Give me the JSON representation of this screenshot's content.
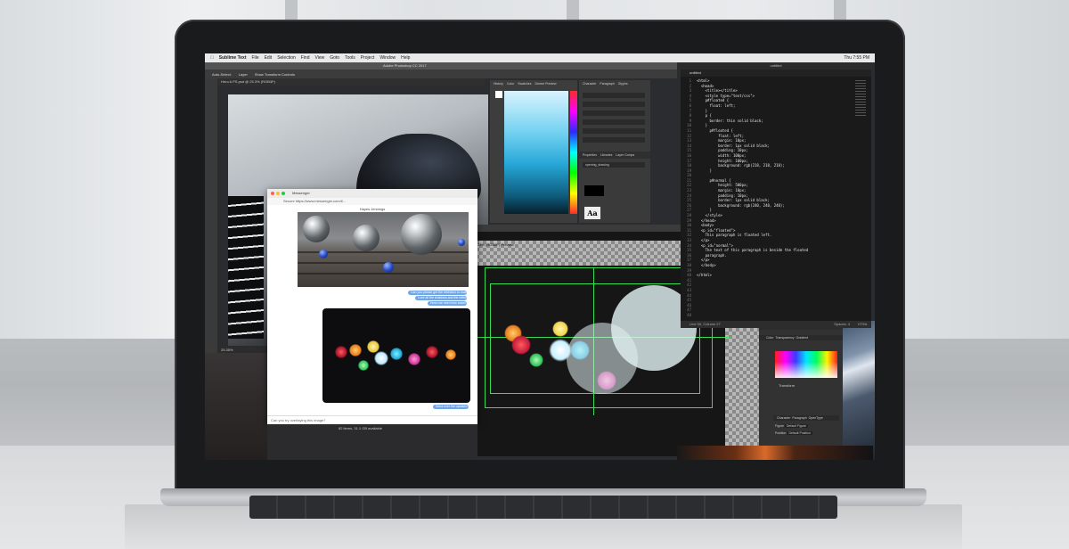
{
  "menubar": {
    "app_name": "Sublime Text",
    "items": [
      "File",
      "Edit",
      "Selection",
      "Find",
      "View",
      "Goto",
      "Tools",
      "Project",
      "Window",
      "Help"
    ],
    "clock": "Thu 7:55 PM"
  },
  "photoshop": {
    "window_title": "Adobe Photoshop CC 2017",
    "doc_tab": "Hero A PS.psd @ 25.3% (RGB/8*)",
    "zoom": "25.35%",
    "options_auto_select": "Auto-Select:",
    "options_layer": "Layer",
    "options_transform": "Show Transform Controls",
    "panel_tabs_color": [
      "History",
      "Color",
      "Swatches",
      "Device Preview"
    ],
    "panel_tabs_char": [
      "Character",
      "Paragraph",
      "Glyphs"
    ],
    "libraries_tabs": [
      "Properties",
      "Libraries",
      "Layer Comps"
    ],
    "library_name": "opening_drawing",
    "char_preview": "Aa",
    "lower_doc_tab": "33% (RGB/8*) Preview",
    "lower_opts": [
      "Stroke",
      "Opacity",
      "Fill",
      "Document Setup"
    ],
    "right_tabs": [
      "Color",
      "Transparency",
      "Gradient"
    ],
    "transform_label": "Transform",
    "char_tabs": [
      "Character",
      "Paragraph",
      "OpenType"
    ],
    "figure_label": "Figure",
    "figure_value": "Default Figure",
    "position_label": "Position",
    "position_value": "Default Position"
  },
  "messenger": {
    "title": "Messenger",
    "url": "Secure   https://www.messenger.com/t/...",
    "header": "Hayes Jennings",
    "bubbles": [
      "Can you please get the reflection to match?",
      "Love all the shadows and the reflections",
      "Hmm we need less bokeh?"
    ],
    "last_bubble": "Send over the updated file!",
    "input_placeholder": "Can you try overlaying this image?",
    "footer": "82 items, 31.1 GB available"
  },
  "editor": {
    "window_title": "untitled",
    "tab": "untitled",
    "status": "Line 50, Column 27",
    "status_right": "HTML",
    "right_label": "Spaces: 4",
    "line_numbers": "1\n2\n3\n4\n5\n6\n7\n8\n9\n10\n11\n12\n13\n14\n15\n16\n17\n18\n19\n20\n21\n22\n23\n24\n25\n26\n27\n28\n29\n30\n31\n32\n33\n34\n35\n36\n37\n38\n39\n40\n41\n42\n43\n44\n45\n46\n47\n48",
    "code": "<html>\n  <head>\n    <title></title>\n    <style type=\"text/css\">\n    p#floated {\n      float: left;\n    }\n    p {\n      border: thin solid black;\n    }\n      p#floated {\n          float: left;\n          margin: 10px;\n          border: 1px solid black;\n          padding: 10px;\n          width: 100px;\n          height: 100px;\n          background: rgb(218, 218, 218);\n      }\n\n      p#normal {\n          height: 500px;\n          margin: 10px;\n          padding: 10px;\n          border: 1px solid black;\n          background: rgb(240, 240, 240);\n      }\n    </style>\n  </head>\n  <body>\n  <p id=\"floated\">\n    This paragraph is floated left.\n  </p>\n  <p id=\"normal\">\n    The text of this paragraph is beside the floated\n    paragraph.\n  </p>\n  </body>\n\n</html>"
  },
  "colors": {
    "laptop_bezel": "#1a1b1d",
    "editor_bg": "#1a1a1a",
    "ps_panel": "#3c3c3c",
    "messenger_bubble": "#72a7e6",
    "guide_green": "#3ddc55"
  }
}
